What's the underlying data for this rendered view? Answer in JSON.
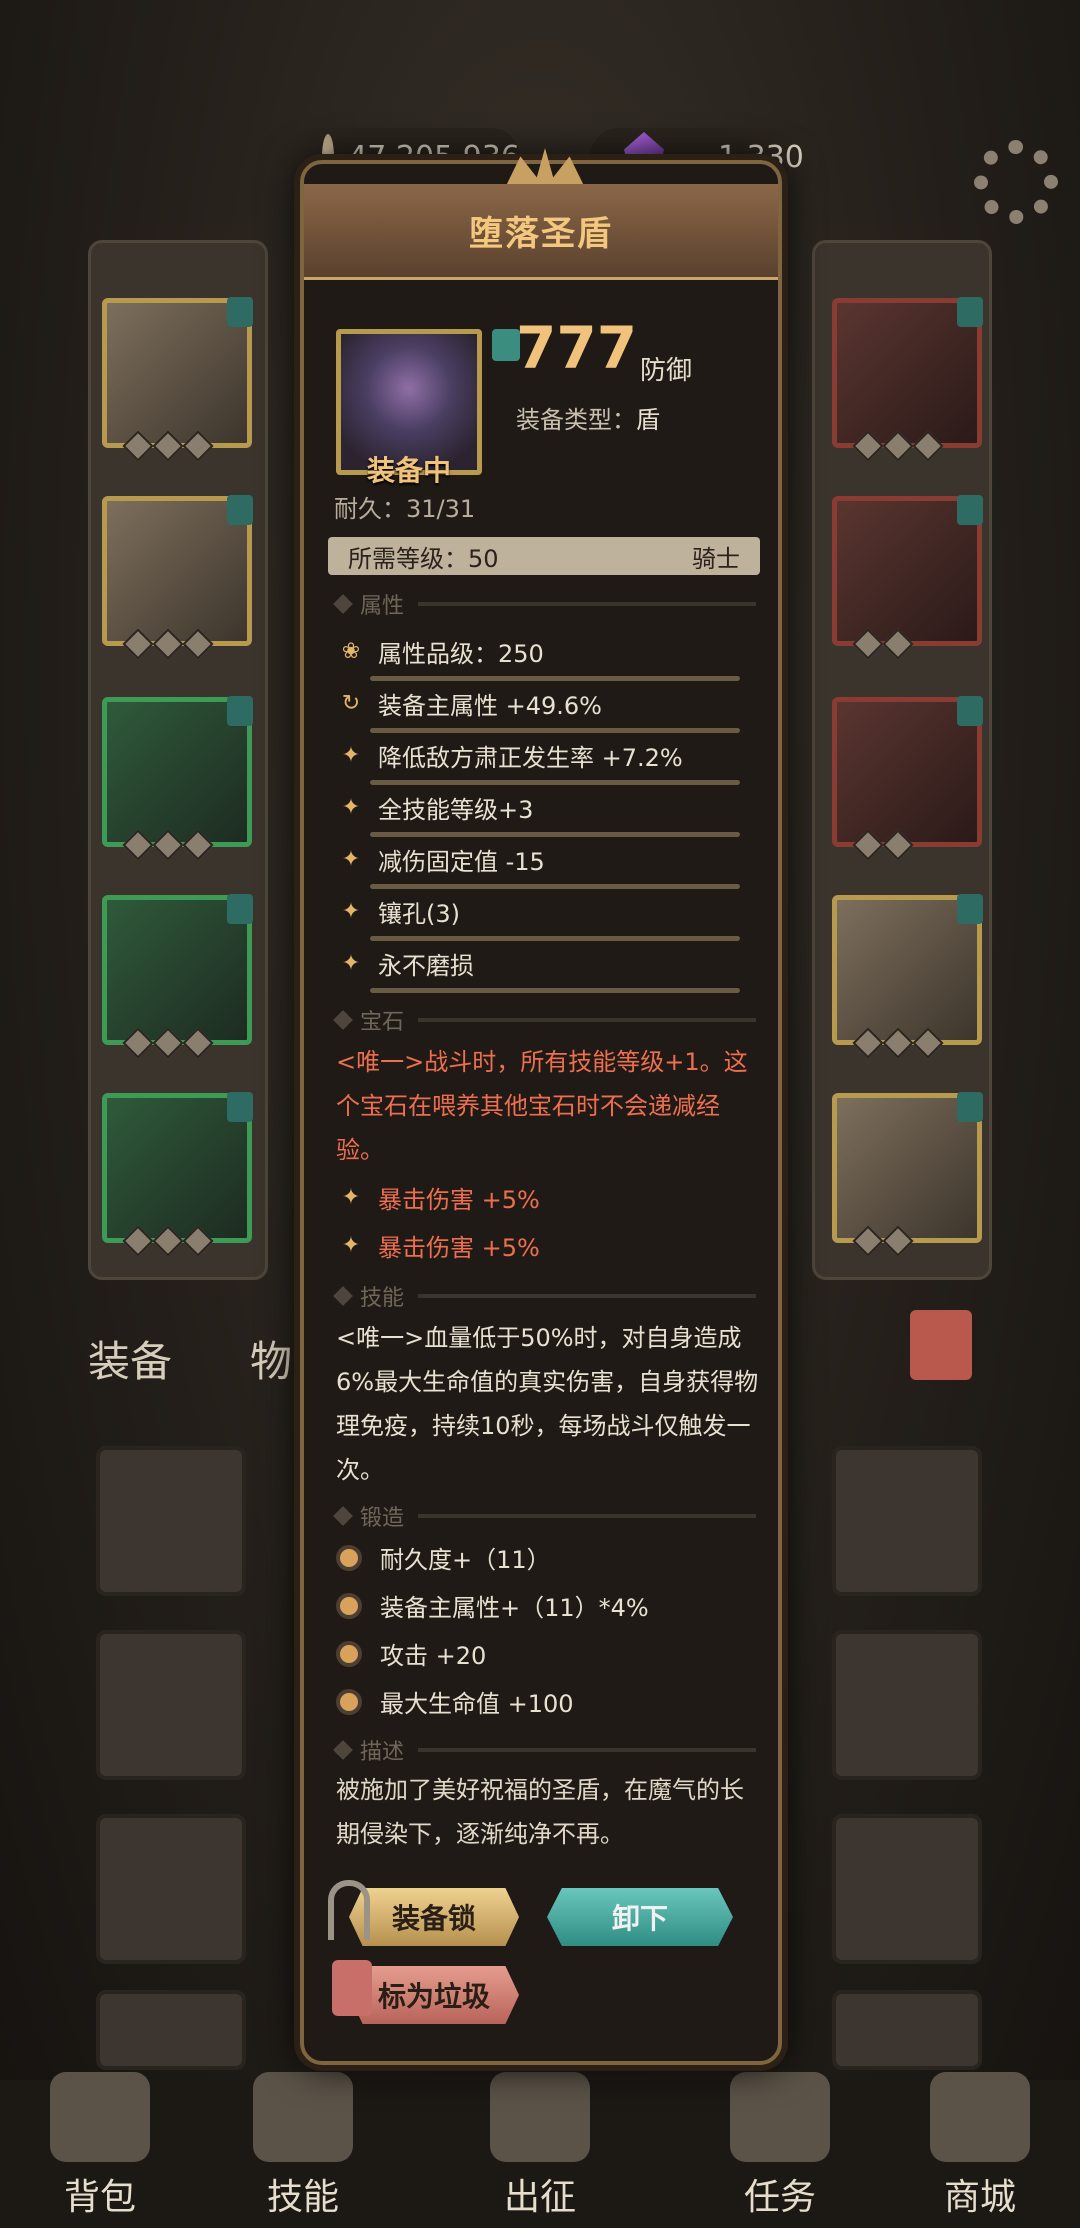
{
  "currency": {
    "coins": "47,205,936",
    "gems": "1,330"
  },
  "dialog": {
    "title": "堕落圣盾",
    "status": "装备中",
    "value": "777",
    "value_unit": "防御",
    "type_label": "装备类型：",
    "type_value": "盾",
    "durability": "耐久：31/31",
    "req_level": "所需等级：50",
    "req_class": "骑士",
    "sections": {
      "attrs": "属性",
      "gem": "宝石",
      "skill": "技能",
      "forge": "锻造",
      "desc": "描述"
    },
    "attr_grade": "属性品级：250",
    "attrs": [
      "装备主属性 +49.6%",
      "降低敌方肃正发生率 +7.2%",
      "全技能等级+3",
      "减伤固定值 -15",
      "镶孔(3)",
      "永不磨损"
    ],
    "gem_text": "<唯一>战斗时，所有技能等级+1。这个宝石在喂养其他宝石时不会递减经验。",
    "gem_attrs": [
      "暴击伤害 +5%",
      "暴击伤害 +5%"
    ],
    "skill_text": "<唯一>血量低于50%时，对自身造成6%最大生命值的真实伤害，自身获得物理免疫，持续10秒，每场战斗仅触发一次。",
    "forge": [
      "耐久度+（11）",
      "装备主属性+（11）*4%",
      "攻击 +20",
      "最大生命值 +100"
    ],
    "description": "被施加了美好祝福的圣盾，在魔气的长期侵染下，逐渐纯净不再。",
    "buttons": {
      "lock": "装备锁",
      "unequip": "卸下",
      "junk": "标为垃圾"
    }
  },
  "bag_tabs": {
    "equip": "装备",
    "items": "物品"
  },
  "nav": [
    "背包",
    "技能",
    "出征",
    "任务",
    "商城"
  ],
  "colors": {
    "accent": "#f0c27b",
    "red_text": "#ee6f4f",
    "teal": "#2f8d84"
  }
}
